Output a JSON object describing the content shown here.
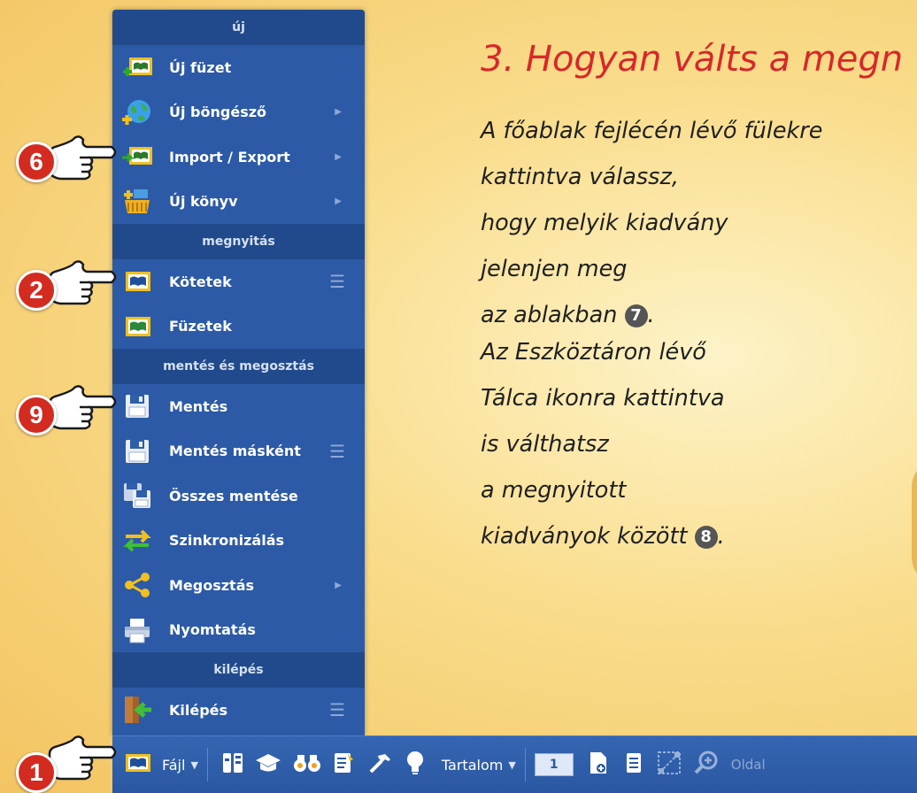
{
  "menu": {
    "sections": {
      "new": "új",
      "open": "megnyitás",
      "save_share": "mentés és megosztás",
      "exit": "kilépés"
    },
    "items": [
      {
        "label": "Új füzet",
        "icon": "new-notebook-icon"
      },
      {
        "label": "Új böngésző",
        "icon": "new-browser-globe-icon",
        "submenu": true
      },
      {
        "label": "Import / Export",
        "icon": "import-export-icon",
        "submenu": true
      },
      {
        "label": "Új könyv",
        "icon": "new-book-basket-icon",
        "submenu": true
      },
      {
        "label": "Kötetek",
        "icon": "volumes-book-icon",
        "list": true
      },
      {
        "label": "Füzetek",
        "icon": "notebooks-icon"
      },
      {
        "label": "Mentés",
        "icon": "floppy-disk-icon"
      },
      {
        "label": "Mentés másként",
        "icon": "floppy-save-as-icon",
        "list": true
      },
      {
        "label": "Összes mentése",
        "icon": "save-all-icon"
      },
      {
        "label": "Szinkronizálás",
        "icon": "sync-arrows-icon"
      },
      {
        "label": "Megosztás",
        "icon": "share-icon",
        "submenu": true
      },
      {
        "label": "Nyomtatás",
        "icon": "printer-icon"
      },
      {
        "label": "Kilépés",
        "icon": "exit-door-icon",
        "list": true
      }
    ]
  },
  "toolbar": {
    "file_label": "Fájl",
    "contents_label": "Tartalom",
    "page_number": "1",
    "page_label": "Oldal"
  },
  "pointers": [
    "6",
    "2",
    "9",
    "1"
  ],
  "text": {
    "heading": "3. Hogyan válts a megn",
    "para1": [
      "A főablak fejlécén lévő fülekre",
      "kattintva válassz,",
      "hogy melyik kiadvány",
      "jelenjen meg",
      "az ablakban"
    ],
    "para1_marker": "7",
    "para2": [
      "Az Eszköztáron lévő",
      "Tálca ikonra kattintva",
      "is válthatsz",
      "a megnyitott",
      "kiadványok között"
    ],
    "para2_marker": "8"
  },
  "colors": {
    "menu_bg": "#2c5aa6",
    "section_bg": "#204a8c",
    "heading_red": "#d8272a",
    "badge_red": "#d32b20"
  }
}
